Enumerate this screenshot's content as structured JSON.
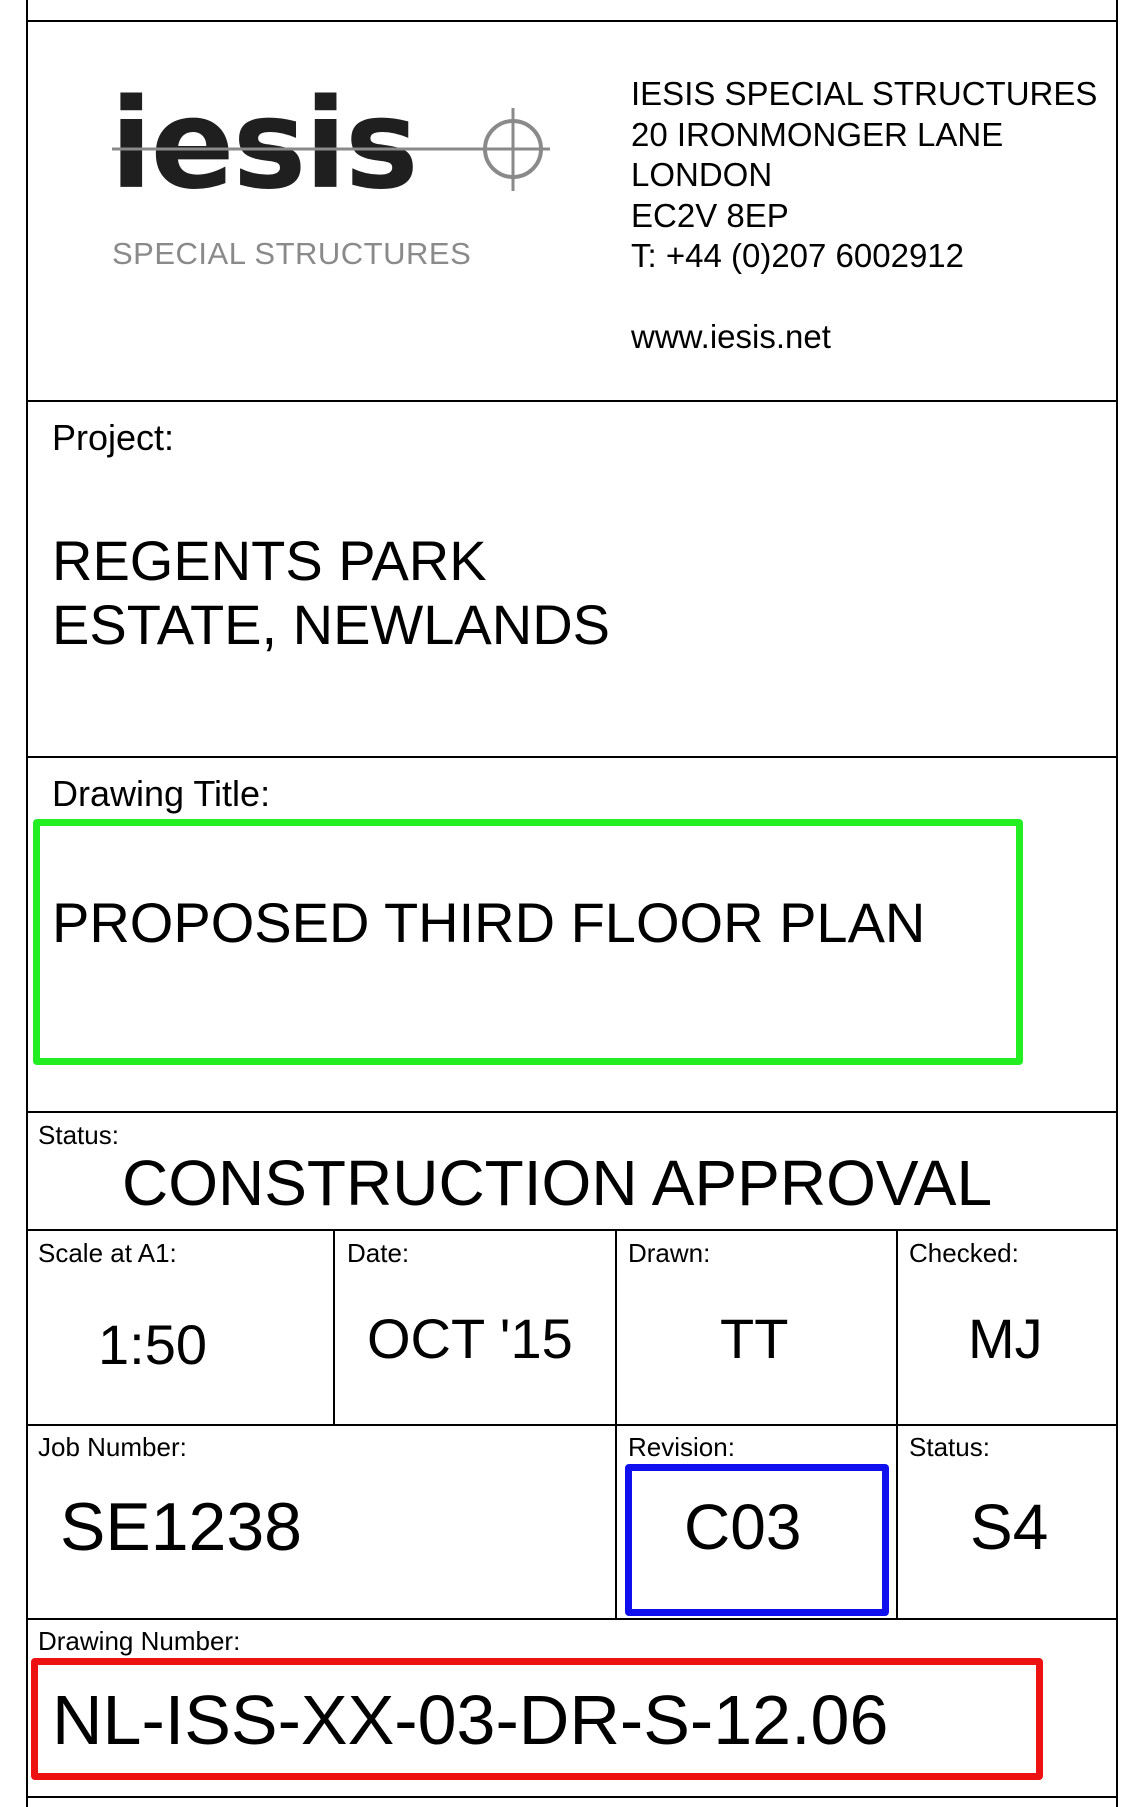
{
  "company": {
    "logo_word": "iesis",
    "logo_tagline": "SPECIAL STRUCTURES",
    "address_lines": [
      "IESIS SPECIAL STRUCTURES",
      "20 IRONMONGER LANE",
      "LONDON",
      "EC2V 8EP",
      "T: +44 (0)207 6002912"
    ],
    "website": "www.iesis.net"
  },
  "project": {
    "label": "Project:",
    "line1": "REGENTS PARK",
    "line2": "ESTATE, NEWLANDS"
  },
  "drawing_title": {
    "label": "Drawing Title:",
    "value": "PROPOSED THIRD FLOOR PLAN"
  },
  "status_main": {
    "label": "Status:",
    "value": "CONSTRUCTION APPROVAL"
  },
  "scale": {
    "label": "Scale at A1:",
    "value": "1:50"
  },
  "date": {
    "label": "Date:",
    "value": "OCT '15"
  },
  "drawn": {
    "label": "Drawn:",
    "value": "TT"
  },
  "checked": {
    "label": "Checked:",
    "value": "MJ"
  },
  "job_number": {
    "label": "Job Number:",
    "value": "SE1238"
  },
  "revision": {
    "label": "Revision:",
    "value": "C03"
  },
  "status_code": {
    "label": "Status:",
    "value": "S4"
  },
  "drawing_number": {
    "label": "Drawing Number:",
    "value": "NL-ISS-XX-03-DR-S-12.06"
  },
  "colors": {
    "highlight_green": "#22ee22",
    "highlight_blue": "#1010ee",
    "highlight_red": "#ee1111",
    "logo_grey": "#8a8a8a"
  }
}
